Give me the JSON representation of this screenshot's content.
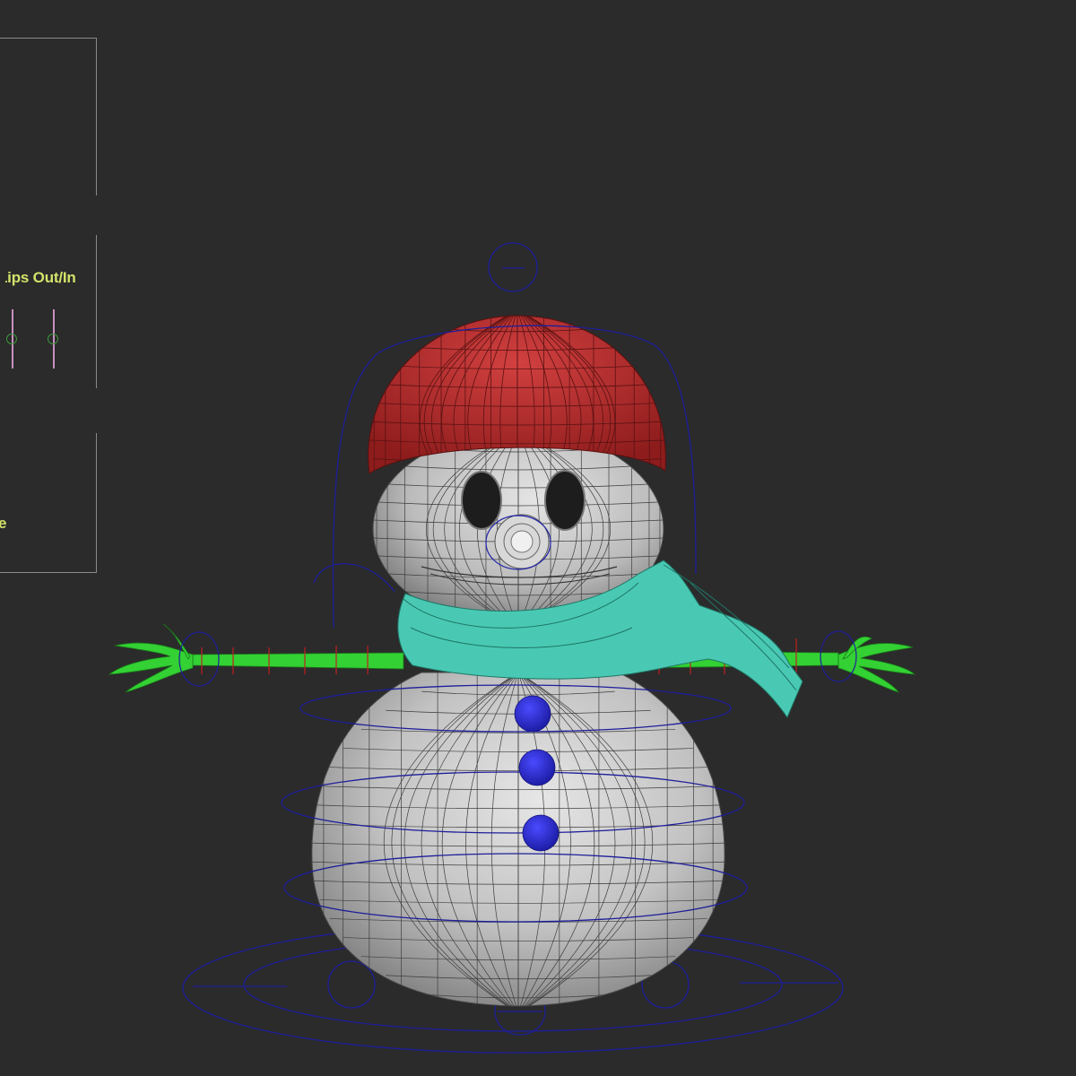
{
  "viewport": {
    "background": "#2b2b2b",
    "rig_panel": {
      "label_lips": "Lips Out/In",
      "label_bottom_fragment": "e",
      "sliders": [
        {
          "name": "lips-out-in-slider-1",
          "value": 0.5
        },
        {
          "name": "lips-out-in-slider-2",
          "value": 0.5
        }
      ],
      "label_color": "#d4e26a"
    },
    "model": {
      "name": "snowman",
      "colors": {
        "body": "#bfbfbf",
        "hat": "#b52a2a",
        "scarf": "#49c9b3",
        "arms": "#33d133",
        "buttons": "#2626c8",
        "eyes": "#1d1d1d",
        "controls": "#1e1e9a"
      },
      "buttons_count": 3
    }
  }
}
